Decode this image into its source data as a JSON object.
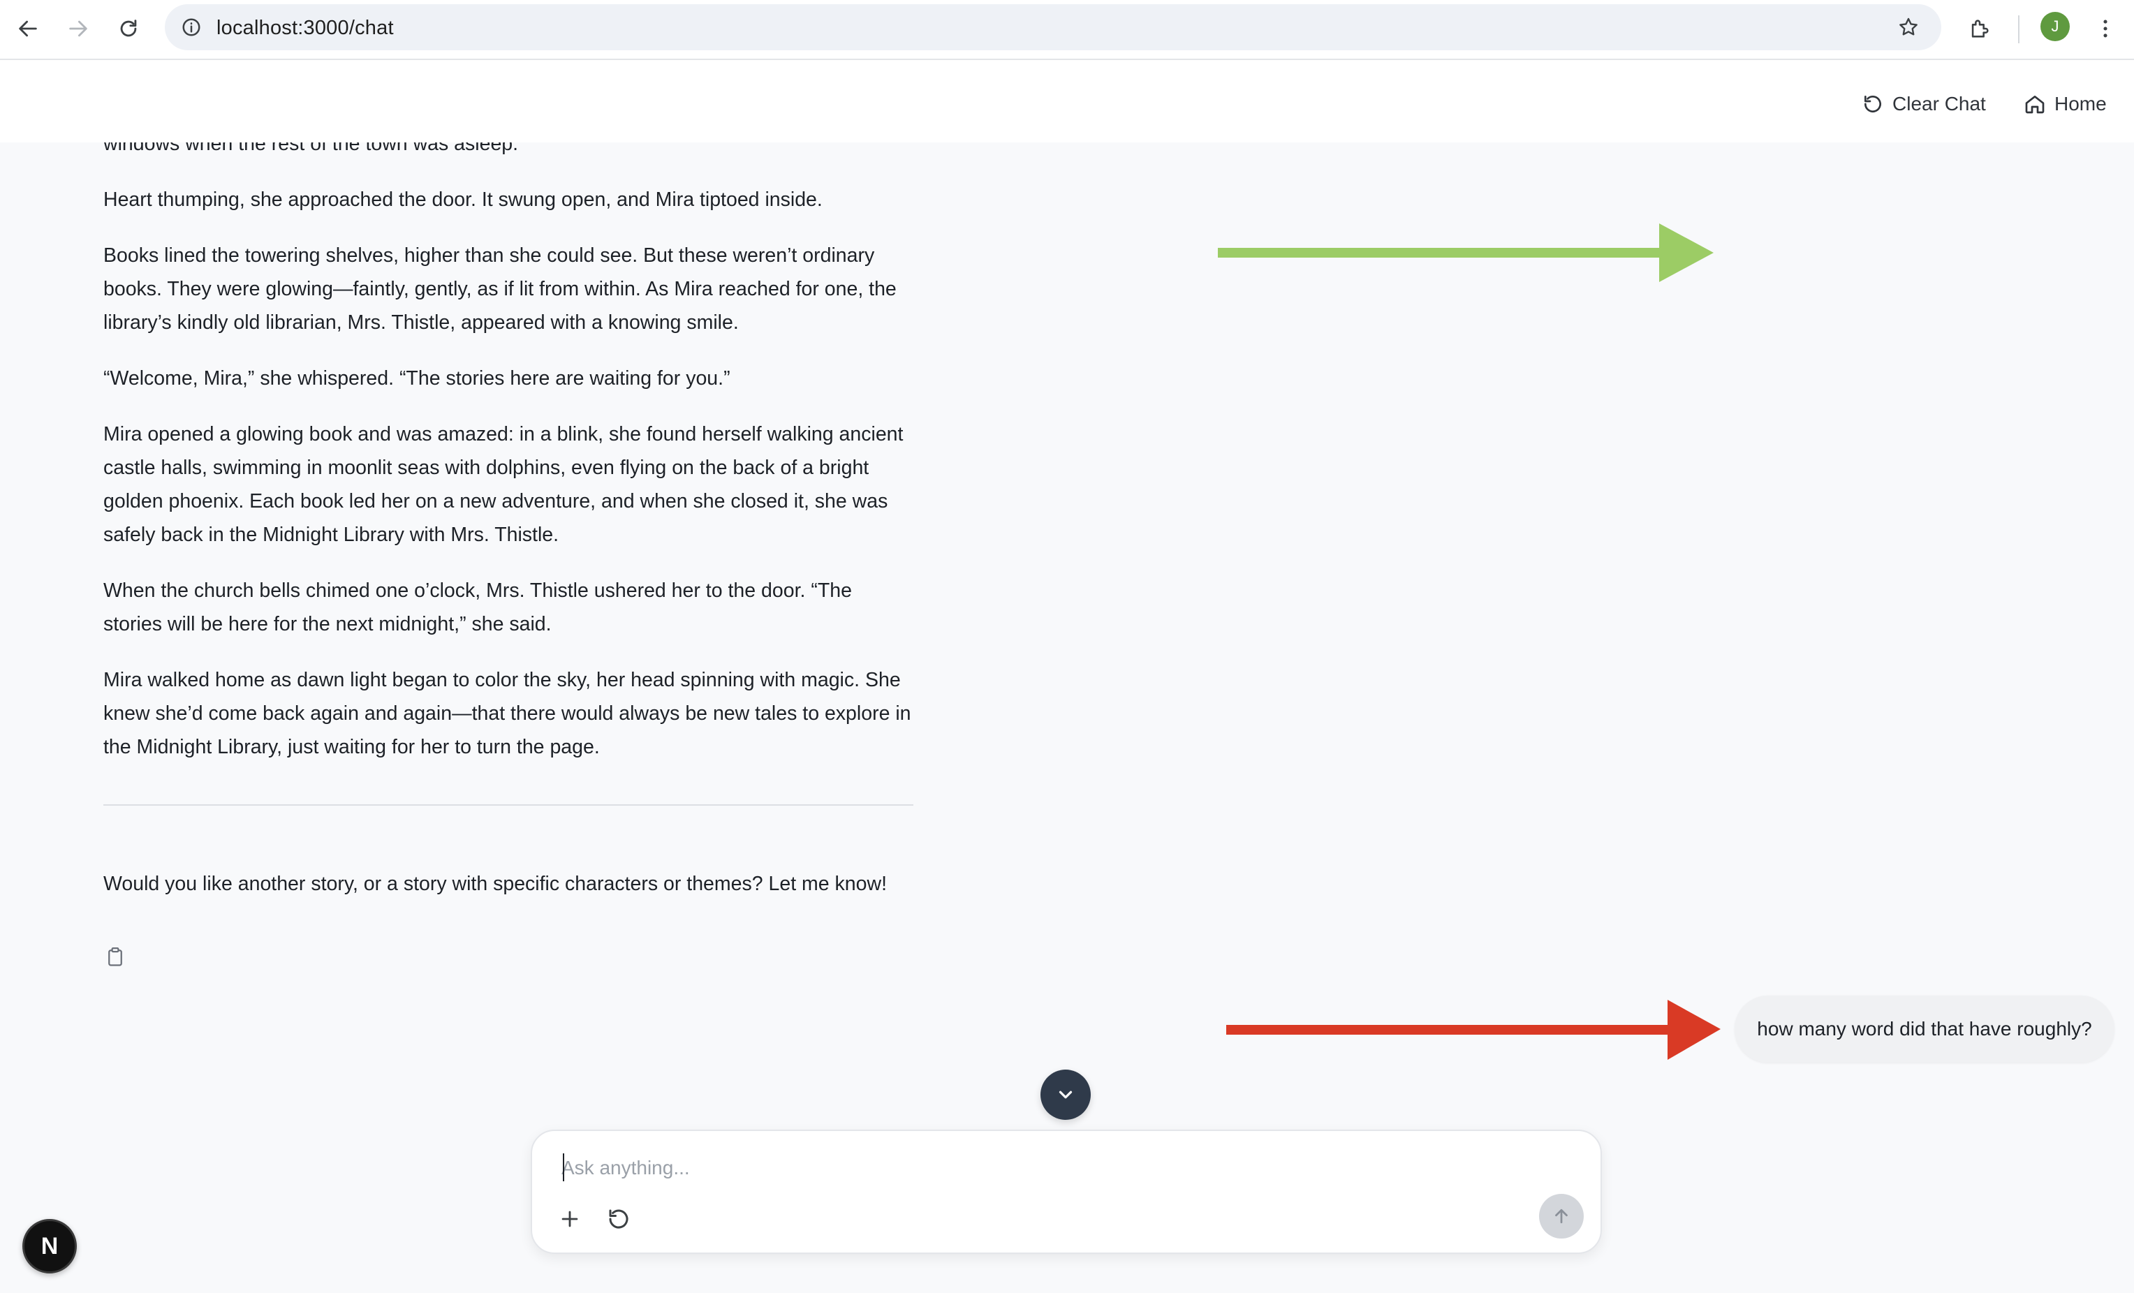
{
  "browser": {
    "url": "localhost:3000/chat",
    "profile_initial": "J"
  },
  "header": {
    "clear_chat_label": "Clear Chat",
    "home_label": "Home"
  },
  "assistant_message": {
    "paragraphs": [
      "windows when the rest of the town was asleep.",
      "Heart thumping, she approached the door. It swung open, and Mira tiptoed inside.",
      "Books lined the towering shelves, higher than she could see. But these weren’t ordinary books. They were glowing—faintly, gently, as if lit from within. As Mira reached for one, the library’s kindly old librarian, Mrs. Thistle, appeared with a knowing smile.",
      "“Welcome, Mira,” she whispered. “The stories here are waiting for you.”",
      "Mira opened a glowing book and was amazed: in a blink, she found herself walking ancient castle halls, swimming in moonlit seas with dolphins, even flying on the back of a bright golden phoenix. Each book led her on a new adventure, and when she closed it, she was safely back in the Midnight Library with Mrs. Thistle.",
      "When the church bells chimed one o’clock, Mrs. Thistle ushered her to the door. “The stories will be here for the next midnight,” she said.",
      "Mira walked home as dawn light began to color the sky, her head spinning with magic. She knew she’d come back again and again—that there would always be new tales to explore in the Midnight Library, just waiting for her to turn the page."
    ],
    "follow_up": "Would you like another story, or a story with specific characters or themes? Let me know!"
  },
  "user_message": {
    "text": "how many word did that have roughly?"
  },
  "composer": {
    "placeholder": "Ask anything...",
    "value": ""
  },
  "dev_badge": {
    "label": "N"
  },
  "colors": {
    "annotation_green": "#9ccc65",
    "annotation_red": "#d93a25",
    "scroll_button": "#2f3a4a",
    "send_disabled": "#d3d6db"
  }
}
